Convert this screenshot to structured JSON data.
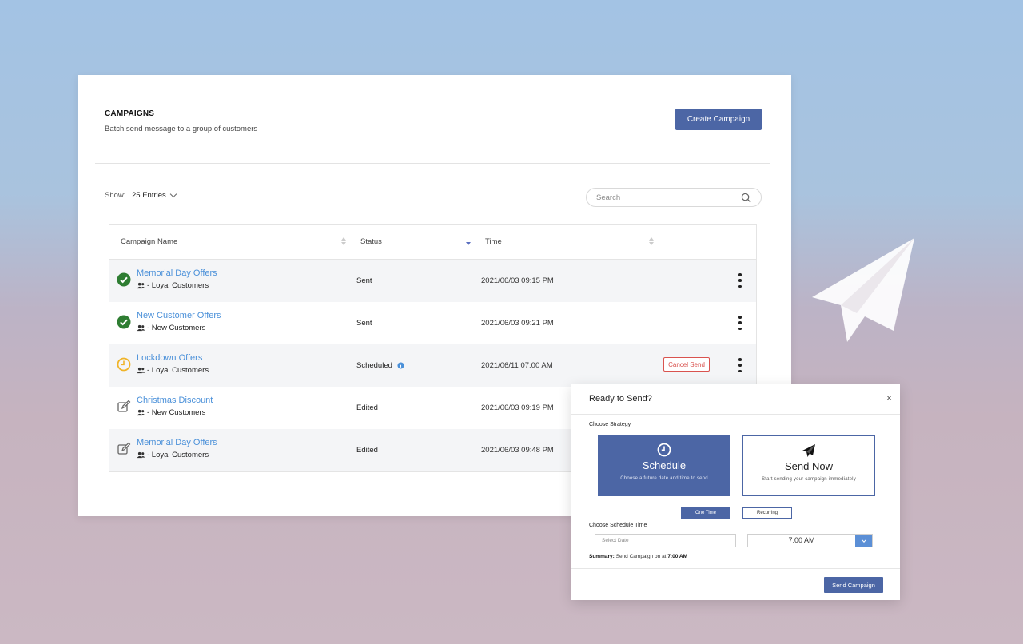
{
  "page": {
    "title": "CAMPAIGNS",
    "subtitle": "Batch send message to a group of customers",
    "create_button": "Create Campaign"
  },
  "controls": {
    "show_label": "Show:",
    "entries_value": "25 Entries",
    "search_placeholder": "Search"
  },
  "table": {
    "columns": [
      "Campaign Name",
      "Status",
      "Time"
    ],
    "sort_active_column": "Status",
    "rows": [
      {
        "name": "Memorial Day Offers",
        "group": "- Loyal Customers",
        "status": "Sent",
        "time": "2021/06/03 09:15 PM",
        "icon": "check-circle-icon"
      },
      {
        "name": "New Customer Offers",
        "group": "- New Customers",
        "status": "Sent",
        "time": "2021/06/03 09:21 PM",
        "icon": "check-circle-icon"
      },
      {
        "name": "Lockdown Offers",
        "group": "- Loyal Customers",
        "status": "Scheduled",
        "time": "2021/06/11 07:00 AM",
        "icon": "clock-icon",
        "action": "Cancel Send"
      },
      {
        "name": "Christmas Discount",
        "group": "- New Customers",
        "status": "Edited",
        "time": "2021/06/03 09:19 PM",
        "icon": "edit-icon"
      },
      {
        "name": "Memorial Day Offers",
        "group": "- Loyal Customers",
        "status": "Edited",
        "time": "2021/06/03 09:48 PM",
        "icon": "edit-icon"
      }
    ]
  },
  "modal": {
    "title": "Ready to Send?",
    "close": "×",
    "strategy_label": "Choose Strategy",
    "strategies": [
      {
        "title": "Schedule",
        "desc": "Choose a future date and time to send",
        "selected": true,
        "icon": "clock-icon"
      },
      {
        "title": "Send Now",
        "desc": "Start sending your campaign immediately",
        "selected": false,
        "icon": "paper-plane-icon"
      }
    ],
    "tabs": [
      "One Time",
      "Recurring"
    ],
    "schedule_label": "Choose Schedule Time",
    "date_placeholder": "Select Date",
    "time_value": "7:00 AM",
    "summary_prefix": "Summary:",
    "summary_text": "Send Campaign on at",
    "summary_time": "7:00 AM",
    "send_button": "Send Campaign"
  },
  "colors": {
    "primary": "#4c66a5",
    "link": "#4a90d9",
    "success": "#2e7d32",
    "warning": "#f0b429",
    "danger": "#d9534f"
  }
}
